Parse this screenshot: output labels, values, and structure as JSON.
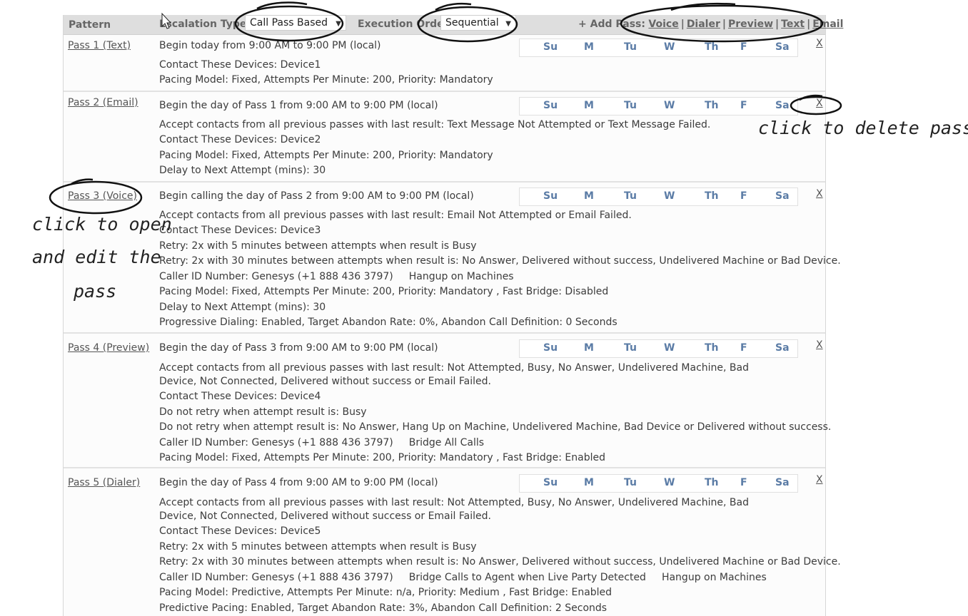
{
  "header": {
    "pattern_label": "Pattern",
    "escalation_label": "Escalation Type",
    "escalation_value": "Call Pass Based",
    "execution_label": "Execution Order",
    "execution_value": "Sequential",
    "add_pass_label": "+ Add Pass:",
    "add_links": [
      "Voice",
      "Dialer",
      "Preview",
      "Text",
      "Email"
    ]
  },
  "days": [
    "Su",
    "M",
    "Tu",
    "W",
    "Th",
    "F",
    "Sa"
  ],
  "delete_label": "X",
  "passes": [
    {
      "name": "Pass 1  (Text)",
      "schedule": "Begin today from  9:00 AM to 9:00 PM (local)",
      "lines": [
        "Contact These Devices: Device1",
        "Pacing Model: Fixed,  Attempts Per Minute: 200,  Priority: Mandatory"
      ]
    },
    {
      "name": "Pass 2  (Email)",
      "schedule": "Begin the day of Pass 1 from  9:00 AM to 9:00 PM (local)",
      "lines": [
        "Accept contacts from all previous passes with last result: Text Message Not Attempted or Text Message Failed.",
        "Contact These Devices: Device2",
        "Pacing Model: Fixed,  Attempts Per Minute: 200,  Priority: Mandatory",
        "Delay to Next Attempt (mins): 30"
      ]
    },
    {
      "name": "Pass 3  (Voice)",
      "schedule": "Begin calling the day of Pass 2 from  9:00 AM to 9:00 PM (local)",
      "lines": [
        "Accept contacts from all previous passes with last result: Email Not Attempted or Email Failed.",
        "Contact These Devices: Device3",
        "Retry: 2x with 5 minutes between attempts when result is Busy",
        "Retry: 2x with 30 minutes between attempts when result is: No Answer, Delivered without success, Undelivered Machine or Bad Device.",
        "Caller ID Number: Genesys (+1 888 436 3797)",
        "Pacing Model: Fixed,  Attempts Per Minute: 200,  Priority: Mandatory , Fast Bridge: Disabled",
        "Delay to Next Attempt (mins): 30",
        "Progressive Dialing: Enabled, Target Abandon Rate: 0%, Abandon Call Definition: 0 Seconds"
      ],
      "caller_extra": [
        "Hangup on Machines"
      ]
    },
    {
      "name": "Pass 4  (Preview)",
      "schedule": "Begin the day of Pass 3 from  9:00 AM to 9:00 PM (local)",
      "lines": [
        "Accept contacts from all previous passes with last result: Not Attempted, Busy, No Answer, Undelivered Machine, Bad Device, Not Connected, Delivered without success or Email Failed.",
        "Contact These Devices: Device4",
        "Do not retry when attempt result is: Busy",
        "Do not retry when attempt result is: No Answer, Hang Up on Machine, Undelivered Machine, Bad Device or Delivered without success.",
        "Caller ID Number: Genesys (+1 888 436 3797)",
        "Pacing Model: Fixed,  Attempts Per Minute: 200,  Priority: Mandatory , Fast Bridge: Enabled"
      ],
      "caller_extra": [
        "Bridge All Calls"
      ]
    },
    {
      "name": "Pass 5  (Dialer)",
      "schedule": "Begin the day of Pass 4 from  9:00 AM to 9:00 PM (local)",
      "lines": [
        "Accept contacts from all previous passes with last result: Not Attempted, Busy, No Answer, Undelivered Machine, Bad Device, Not Connected, Delivered without success or Email Failed.",
        "Contact These Devices: Device5",
        "Retry: 2x with 5 minutes between attempts when result is Busy",
        "Retry: 2x with 30 minutes between attempts when result is: No Answer, Delivered without success, Undelivered Machine or Bad Device.",
        "Caller ID Number: Genesys (+1 888 436 3797)",
        "Pacing Model: Predictive,  Attempts Per Minute: n/a,  Priority: Medium , Fast Bridge: Enabled",
        "Predictive Pacing: Enabled, Target Abandon Rate: 3%, Abandon Call Definition: 2 Seconds"
      ],
      "caller_extra": [
        "Bridge Calls to Agent when Live Party Detected",
        "Hangup on Machines"
      ]
    }
  ],
  "annotations": {
    "delete": "click to delete pass",
    "open_line1": "click to open",
    "open_line2": "and edit the",
    "open_line3": "pass"
  }
}
